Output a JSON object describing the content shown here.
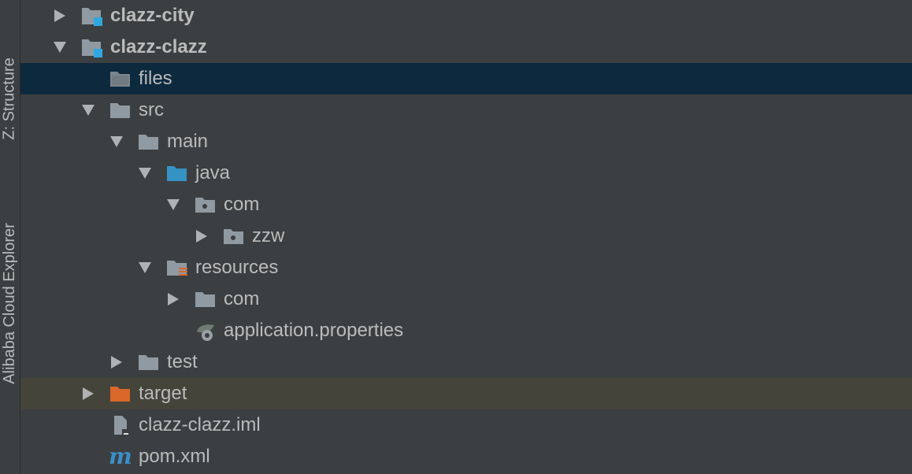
{
  "sidebar": {
    "tabs": [
      {
        "label": "Z: Structure"
      },
      {
        "label": "Alibaba Cloud Explorer"
      }
    ]
  },
  "colors": {
    "background": "#3c3f41",
    "selected_row": "#0d293e",
    "excluded_row": "#45443b",
    "folder_gray": "#8f9aa3",
    "source_folder": "#3592c4",
    "module_badge": "#2fa7e0",
    "excluded_folder": "#d9682a",
    "maven_blue": "#3a8fc7"
  },
  "tree": {
    "items": [
      {
        "label": "clazz-city",
        "icon": "module-folder-icon",
        "expanded": false
      },
      {
        "label": "clazz-clazz",
        "icon": "module-folder-icon",
        "expanded": true
      },
      {
        "label": "files",
        "icon": "folder-icon",
        "selected": true
      },
      {
        "label": "src",
        "icon": "folder-icon",
        "expanded": true
      },
      {
        "label": "main",
        "icon": "folder-icon",
        "expanded": true
      },
      {
        "label": "java",
        "icon": "source-folder-icon",
        "expanded": true
      },
      {
        "label": "com",
        "icon": "package-icon",
        "expanded": true
      },
      {
        "label": "zzw",
        "icon": "package-icon",
        "expanded": false
      },
      {
        "label": "resources",
        "icon": "resources-folder-icon",
        "expanded": true
      },
      {
        "label": "com",
        "icon": "folder-icon",
        "expanded": false
      },
      {
        "label": "application.properties",
        "icon": "spring-properties-icon"
      },
      {
        "label": "test",
        "icon": "folder-icon",
        "expanded": false
      },
      {
        "label": "target",
        "icon": "excluded-folder-icon",
        "expanded": false
      },
      {
        "label": "clazz-clazz.iml",
        "icon": "iml-file-icon"
      },
      {
        "label": "pom.xml",
        "icon": "maven-icon"
      }
    ]
  }
}
